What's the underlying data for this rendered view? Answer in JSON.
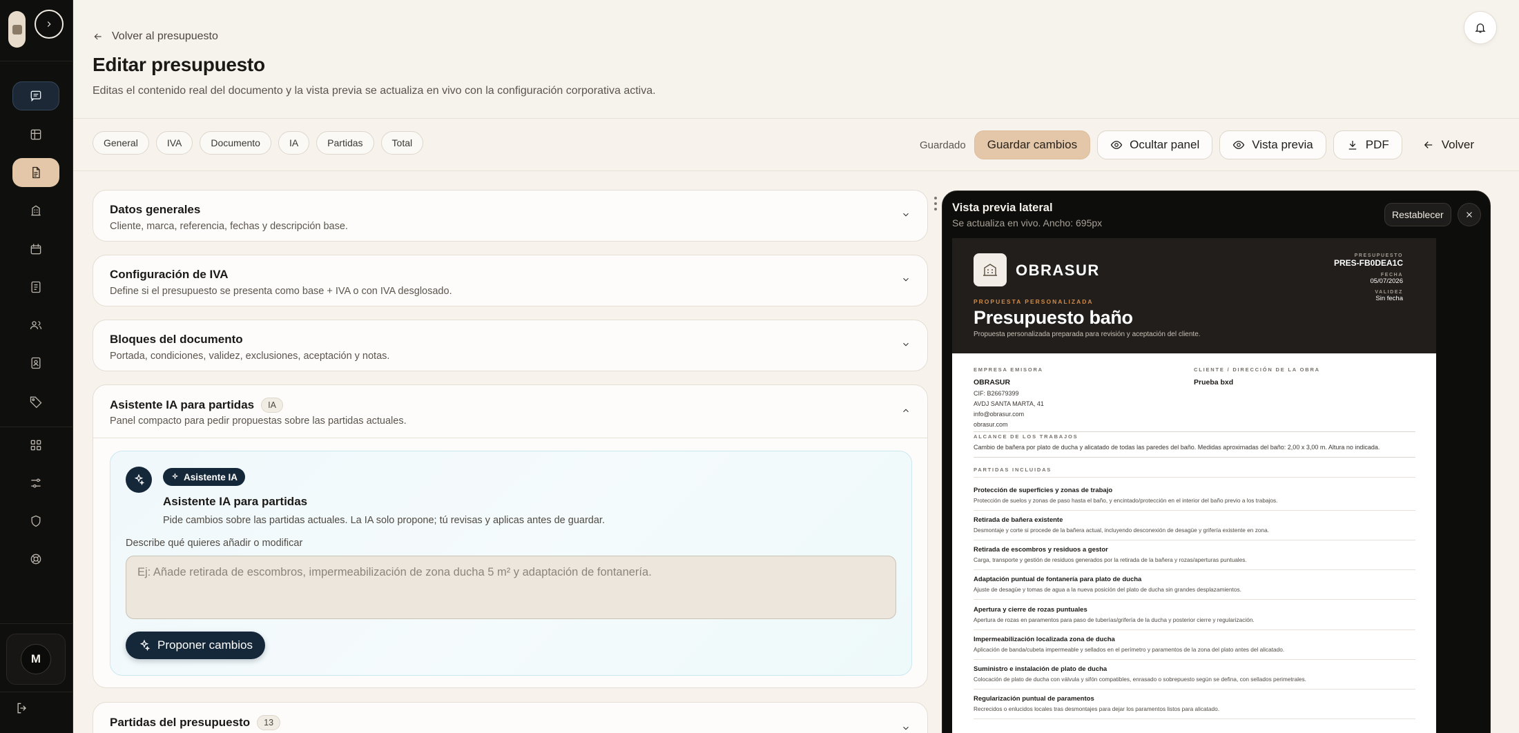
{
  "header": {
    "back_label": "Volver al presupuesto",
    "title": "Editar presupuesto",
    "subtitle": "Editas el contenido real del documento y la vista previa se actualiza en vivo con la configuración corporativa activa."
  },
  "sidebar": {
    "user_initial": "M",
    "items": [
      "messages",
      "table",
      "document",
      "building",
      "calendar",
      "notes",
      "users",
      "contacts",
      "tags",
      "grid",
      "sliders",
      "shield",
      "support"
    ]
  },
  "tabs": [
    "General",
    "IVA",
    "Documento",
    "IA",
    "Partidas",
    "Total"
  ],
  "toolbar": {
    "saved_status": "Guardado",
    "save_label": "Guardar cambios",
    "hide_panel_label": "Ocultar panel",
    "preview_label": "Vista previa",
    "pdf_label": "PDF",
    "back_label": "Volver"
  },
  "sections": {
    "general": {
      "title": "Datos generales",
      "desc": "Cliente, marca, referencia, fechas y descripción base."
    },
    "iva": {
      "title": "Configuración de IVA",
      "desc": "Define si el presupuesto se presenta como base + IVA o con IVA desglosado."
    },
    "blocks": {
      "title": "Bloques del documento",
      "desc": "Portada, condiciones, validez, exclusiones, aceptación y notas."
    },
    "ai": {
      "title": "Asistente IA para partidas",
      "badge": "IA",
      "desc": "Panel compacto para pedir propuestas sobre las partidas actuales."
    },
    "items": {
      "title": "Partidas del presupuesto",
      "count": "13"
    }
  },
  "ai_card": {
    "badge": "Asistente IA",
    "title": "Asistente IA para partidas",
    "desc": "Pide cambios sobre las partidas actuales. La IA solo propone; tú revisas y aplicas antes de guardar.",
    "field_label": "Describe qué quieres añadir o modificar",
    "placeholder": "Ej: Añade retirada de escombros, impermeabilización de zona ducha 5 m² y adaptación de fontanería.",
    "button_label": "Proponer cambios"
  },
  "preview": {
    "title": "Vista previa lateral",
    "subtitle": "Se actualiza en vivo. Ancho: 695px",
    "reset_label": "Restablecer"
  },
  "document": {
    "brand": "OBRASUR",
    "kicker": "PROPUESTA PERSONALIZADA",
    "title": "Presupuesto baño",
    "intro": "Propuesta personalizada preparada para revisión y aceptación del cliente.",
    "meta": {
      "budget_label": "PRESUPUESTO",
      "budget_value": "PRES-FB0DEA1C",
      "date_label": "FECHA",
      "date_value": "05/07/2026",
      "validity_label": "VALIDEZ",
      "validity_value": "Sin fecha"
    },
    "issuer": {
      "label": "EMPRESA EMISORA",
      "name": "OBRASUR",
      "cif": "CIF: B26679399",
      "address": "AVDJ SANTA MARTA, 41",
      "email": "info@obrasur.com",
      "web": "obrasur.com"
    },
    "client": {
      "label": "CLIENTE / DIRECCIÓN DE LA OBRA",
      "name": "Prueba bxd"
    },
    "scope": {
      "label": "ALCANCE DE LOS TRABAJOS",
      "text": "Cambio de bañera por plato de ducha y alicatado de todas las paredes del baño. Medidas aproximadas del baño: 2,00 x 3,00 m. Altura no indicada."
    },
    "items_label": "PARTIDAS INCLUIDAS",
    "items": [
      {
        "title": "Protección de superficies y zonas de trabajo",
        "desc": "Protección de suelos y zonas de paso hasta el baño, y encintado/protección en el interior del baño previo a los trabajos."
      },
      {
        "title": "Retirada de bañera existente",
        "desc": "Desmontaje y corte si procede de la bañera actual, incluyendo desconexión de desagüe y grifería existente en zona."
      },
      {
        "title": "Retirada de escombros y residuos a gestor",
        "desc": "Carga, transporte y gestión de residuos generados por la retirada de la bañera y rozas/aperturas puntuales."
      },
      {
        "title": "Adaptación puntual de fontanería para plato de ducha",
        "desc": "Ajuste de desagüe y tomas de agua a la nueva posición del plato de ducha sin grandes desplazamientos."
      },
      {
        "title": "Apertura y cierre de rozas puntuales",
        "desc": "Apertura de rozas en paramentos para paso de tuberías/grifería de la ducha y posterior cierre y regularización."
      },
      {
        "title": "Impermeabilización localizada zona de ducha",
        "desc": "Aplicación de banda/cubeta impermeable y sellados en el perímetro y paramentos de la zona del plato antes del alicatado."
      },
      {
        "title": "Suministro e instalación de plato de ducha",
        "desc": "Colocación de plato de ducha con válvula y sifón compatibles, enrasado o sobrepuesto según se defina, con sellados perimetrales."
      },
      {
        "title": "Regularización puntual de paramentos",
        "desc": "Recrecidos o enlucidos locales tras desmontajes para dejar los paramentos listos para alicatado."
      }
    ]
  }
}
